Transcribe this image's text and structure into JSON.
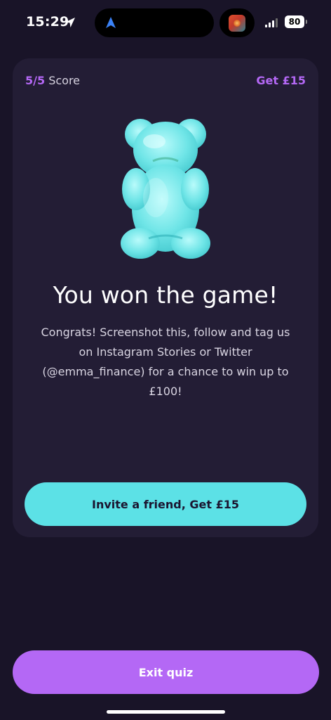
{
  "status_bar": {
    "time": "15:29",
    "battery": "80",
    "icons": [
      "location-arrow-icon",
      "navigation-arrow-icon",
      "cellular-signal-icon",
      "battery-icon"
    ]
  },
  "card": {
    "score_value": "5/5",
    "score_label": "Score",
    "reward_link": "Get £15",
    "illustration": "gummy-bear-icon",
    "headline": "You won the game!",
    "body": "Congrats! Screenshot this, follow and tag us on Instagram Stories or Twitter (@emma_finance) for a chance to win up to £100!",
    "invite_button": "Invite a friend, Get £15"
  },
  "exit_button": "Exit quiz",
  "colors": {
    "background": "#191428",
    "card": "#231d35",
    "accent_purple": "#b468f5",
    "accent_cyan": "#5ce1e6"
  }
}
